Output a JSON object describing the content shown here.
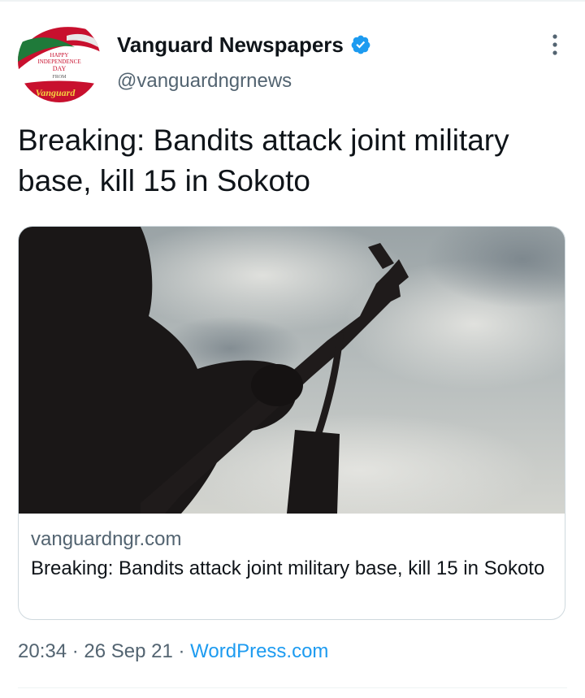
{
  "tweet": {
    "author": {
      "display_name": "Vanguard Newspapers",
      "handle": "@vanguardngrnews",
      "verified": true,
      "avatar": {
        "line1": "HAPPY",
        "line2": "INDEPENDENCE",
        "line3": "DAY",
        "line4": "FROM",
        "brand": "Vanguard"
      }
    },
    "text": "Breaking: Bandits attack joint military base, kill 15 in Sokoto",
    "card": {
      "domain": "vanguardngr.com",
      "title": "Breaking: Bandits attack joint military base, kill 15 in Sokoto"
    },
    "meta": {
      "time": "20:34",
      "separator1": " · ",
      "date": "26 Sep 21",
      "separator2": " · ",
      "source": "WordPress.com"
    }
  },
  "colors": {
    "text_primary": "#0f1419",
    "text_secondary": "#536471",
    "link": "#1d9bf0",
    "verified_badge": "#1d9bf0",
    "border": "#cfd9de"
  },
  "icons": {
    "verified": "verified-badge-icon",
    "more": "more-vertical-icon"
  }
}
